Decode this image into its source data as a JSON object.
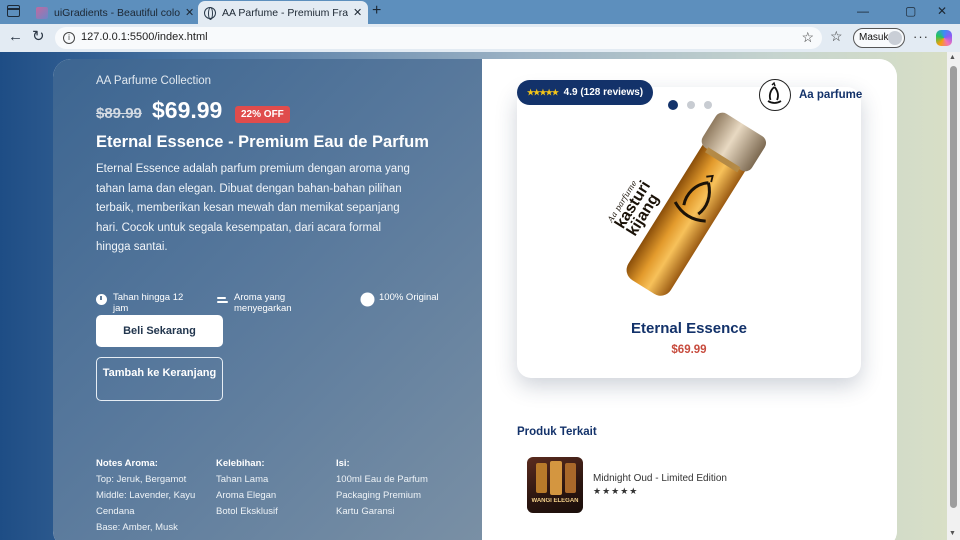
{
  "browser": {
    "tabs": [
      {
        "title": "uiGradients - Beautiful colored gr",
        "close": "✕"
      },
      {
        "title": "AA Parfume - Premium Fragrance",
        "close": "✕"
      }
    ],
    "new_tab": "+",
    "controls": {
      "minimize": "—",
      "maximize": "▢",
      "close": "✕"
    },
    "nav": {
      "back": "←",
      "refresh": "↻"
    },
    "url": "127.0.0.1:5500/index.html",
    "profile_label": "Masuk",
    "more": "···"
  },
  "hero": {
    "collection": "AA Parfume Collection",
    "old_price": "$89.99",
    "new_price": "$69.99",
    "discount": "22% OFF",
    "title": "Eternal Essence - Premium Eau de Parfum",
    "description": "Eternal Essence adalah parfum premium dengan aroma yang tahan lama dan elegan. Dibuat dengan bahan-bahan pilihan terbaik, memberikan kesan mewah dan memikat sepanjang hari. Cocok untuk segala kesempatan, dari acara formal hingga santai.",
    "features": [
      {
        "icon": "clock-icon",
        "label": "Tahan hingga 12 jam"
      },
      {
        "icon": "wind-icon",
        "label": "Aroma yang menyegarkan"
      },
      {
        "icon": "badge-icon",
        "label": "100% Original"
      }
    ],
    "buy_button": "Beli Sekarang",
    "cart_button": "Tambah ke Keranjang",
    "notes": {
      "heading": "Notes Aroma:",
      "lines": [
        "Top: Jeruk, Bergamot",
        "Middle: Lavender, Kayu Cendana",
        "Base: Amber, Musk"
      ]
    },
    "advantages": {
      "heading": "Kelebihan:",
      "lines": [
        "Tahan Lama",
        "Aroma Elegan",
        "Botol Eksklusif"
      ]
    },
    "contents": {
      "heading": "Isi:",
      "lines": [
        "100ml Eau de Parfum",
        "Packaging Premium",
        "Kartu Garansi"
      ]
    }
  },
  "product": {
    "rating_stars": "★★★★★",
    "rating_text": "4.9 (128 reviews)",
    "carousel_position": 1,
    "carousel_total": 3,
    "brand": "Aa parfume",
    "bottle_label_brand": "Aa parfume",
    "bottle_label_name_1": "kasturi",
    "bottle_label_name_2": "kijang",
    "name": "Eternal Essence",
    "price": "$69.99"
  },
  "related": {
    "title": "Produk Terkait",
    "items": [
      {
        "name": "Midnight Oud - Limited Edition",
        "stars": "★★★★★",
        "thumb_text": "WANGI ELEGAN"
      }
    ]
  },
  "colors": {
    "accent_dark": "#13326a",
    "discount_red": "#e04c4c",
    "price_red": "#c74b3d",
    "star_gold": "#f5c518"
  }
}
